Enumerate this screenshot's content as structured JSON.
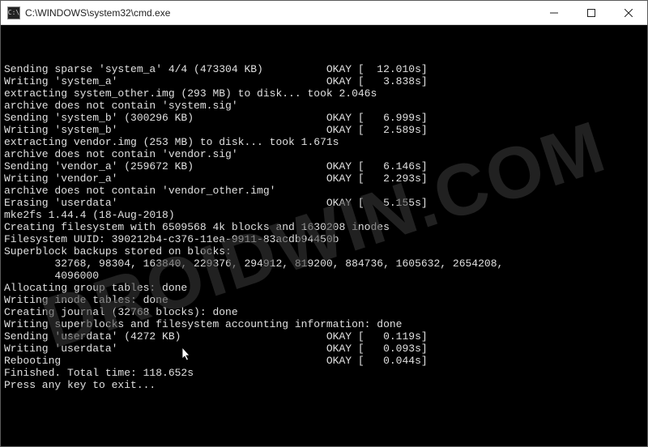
{
  "window": {
    "icon_label": "cmd",
    "title": "C:\\WINDOWS\\system32\\cmd.exe"
  },
  "controls": {
    "minimize": "minimize",
    "maximize": "maximize",
    "close": "close"
  },
  "watermark": "DROIDWIN.COM",
  "console_lines": [
    "Sending sparse 'system_a' 4/4 (473304 KB)          OKAY [  12.010s]",
    "Writing 'system_a'                                 OKAY [   3.838s]",
    "extracting system_other.img (293 MB) to disk... took 2.046s",
    "archive does not contain 'system.sig'",
    "Sending 'system_b' (300296 KB)                     OKAY [   6.999s]",
    "Writing 'system_b'                                 OKAY [   2.589s]",
    "extracting vendor.img (253 MB) to disk... took 1.671s",
    "archive does not contain 'vendor.sig'",
    "Sending 'vendor_a' (259672 KB)                     OKAY [   6.146s]",
    "Writing 'vendor_a'                                 OKAY [   2.293s]",
    "archive does not contain 'vendor_other.img'",
    "Erasing 'userdata'                                 OKAY [   5.155s]",
    "mke2fs 1.44.4 (18-Aug-2018)",
    "Creating filesystem with 6509568 4k blocks and 1630208 inodes",
    "Filesystem UUID: 390212b4-c376-11ea-9911-83acdb94450b",
    "Superblock backups stored on blocks:",
    "        32768, 98304, 163840, 229376, 294912, 819200, 884736, 1605632, 2654208,",
    "        4096000",
    "",
    "Allocating group tables: done",
    "Writing inode tables: done",
    "Creating journal (32768 blocks): done",
    "Writing superblocks and filesystem accounting information: done",
    "",
    "Sending 'userdata' (4272 KB)                       OKAY [   0.119s]",
    "Writing 'userdata'                                 OKAY [   0.093s]",
    "Rebooting                                          OKAY [   0.044s]",
    "Finished. Total time: 118.652s",
    "Press any key to exit..."
  ]
}
